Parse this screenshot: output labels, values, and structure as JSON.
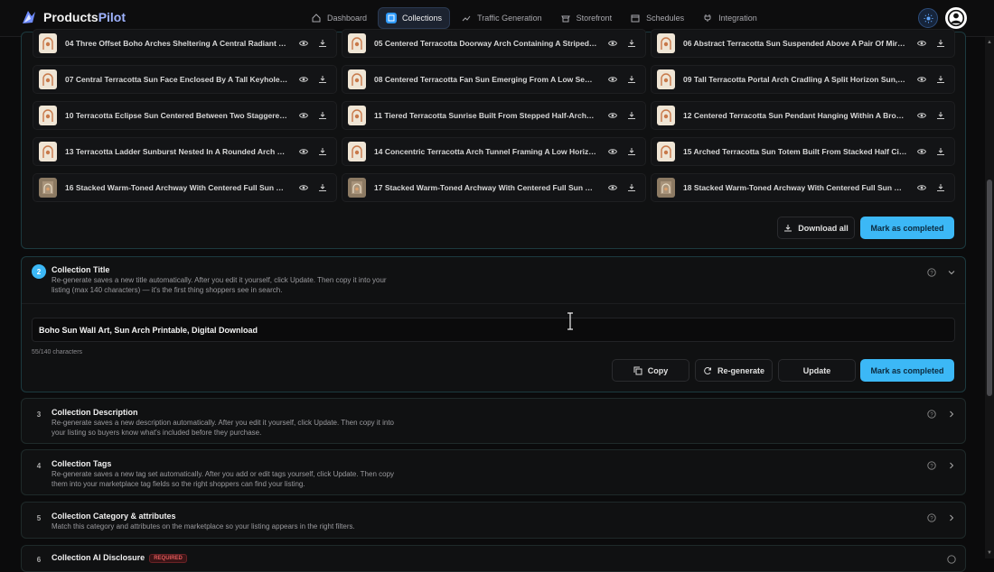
{
  "app": {
    "name_main": "Products",
    "name_accent": "Pilot"
  },
  "nav": [
    {
      "label": "Dashboard",
      "icon": "home-icon",
      "active": false
    },
    {
      "label": "Collections",
      "icon": "collections-icon",
      "active": true
    },
    {
      "label": "Traffic Generation",
      "icon": "trending-up-icon",
      "active": false
    },
    {
      "label": "Storefront",
      "icon": "store-icon",
      "active": false
    },
    {
      "label": "Schedules",
      "icon": "calendar-icon",
      "active": false
    },
    {
      "label": "Integration",
      "icon": "plug-icon",
      "active": false
    }
  ],
  "images": [
    {
      "label": "04 Three Offset Boho Arches Sheltering A Central Radiant Sunburst...",
      "thumb": "illustration"
    },
    {
      "label": "05 Centered Terracotta Doorway Arch Containing A Striped Sun Dis...",
      "thumb": "illustration"
    },
    {
      "label": "06 Abstract Terracotta Sun Suspended Above A Pair Of Mirrored Op...",
      "thumb": "illustration"
    },
    {
      "label": "07 Central Terracotta Sun Face Enclosed By A Tall Keyhole Arch, Wi...",
      "thumb": "illustration"
    },
    {
      "label": "08 Centered Terracotta Fan Sun Emerging From A Low Semicircle A...",
      "thumb": "illustration"
    },
    {
      "label": "09 Tall Terracotta Portal Arch Cradling A Split Horizon Sun, With On...",
      "thumb": "illustration"
    },
    {
      "label": "10 Terracotta Eclipse Sun Centered Between Two Staggered Open ...",
      "thumb": "illustration"
    },
    {
      "label": "11 Tiered Terracotta Sunrise Built From Stepped Half-Arches And A ...",
      "thumb": "illustration"
    },
    {
      "label": "12 Centered Terracotta Sun Pendant Hanging Within A Broad Horse...",
      "thumb": "illustration"
    },
    {
      "label": "13 Terracotta Ladder Sunburst Nested In A Rounded Arch Window, ...",
      "thumb": "illustration"
    },
    {
      "label": "14 Concentric Terracotta Arch Tunnel Framing A Low Horizontal Sun...",
      "thumb": "illustration"
    },
    {
      "label": "15 Arched Terracotta Sun Totem Built From Stacked Half Circles An...",
      "thumb": "illustration"
    },
    {
      "label": "16 Stacked Warm-Toned Archway With Centered Full Sun Disc And ...",
      "thumb": "photo"
    },
    {
      "label": "17 Stacked Warm-Toned Archway With Centered Full Sun Disc And ...",
      "thumb": "photo"
    },
    {
      "label": "18 Stacked Warm-Toned Archway With Centered Full Sun Disc And ...",
      "thumb": "photo"
    }
  ],
  "images_actions": {
    "download_all": "Download all",
    "mark_completed": "Mark as completed"
  },
  "sections": {
    "title": {
      "step": "2",
      "heading": "Collection Title",
      "description": "Re-generate saves a new title automatically. After you edit it yourself, click Update. Then copy it into your listing (max 140 characters) — it's the first thing shoppers see in search.",
      "value": "Boho Sun Wall Art, Sun Arch Printable, Digital Download",
      "char_count": "55/140 characters",
      "copy": "Copy",
      "regenerate": "Re-generate",
      "update": "Update",
      "mark_completed": "Mark as completed"
    },
    "description": {
      "step": "3",
      "heading": "Collection Description",
      "description": "Re-generate saves a new description automatically. After you edit it yourself, click Update. Then copy it into your listing so buyers know what's included before they purchase."
    },
    "tags": {
      "step": "4",
      "heading": "Collection Tags",
      "description": "Re-generate saves a new tag set automatically. After you add or edit tags yourself, click Update. Then copy them into your marketplace tag fields so the right shoppers can find your listing."
    },
    "category": {
      "step": "5",
      "heading": "Collection Category & attributes",
      "description": "Match this category and attributes on the marketplace so your listing appears in the right filters."
    },
    "ai": {
      "step": "6",
      "heading": "Collection AI Disclosure",
      "badge": "REQUIRED"
    }
  },
  "colors": {
    "accent": "#3cb8f6",
    "terracotta": "#c8794a"
  }
}
